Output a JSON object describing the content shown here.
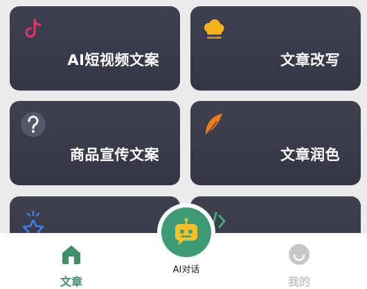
{
  "cards": [
    {
      "title": "AI短视频文案",
      "icon": "tiktok-music-icon"
    },
    {
      "title": "文章改写",
      "icon": "chef-hat-icon"
    },
    {
      "title": "商品宣传文案",
      "icon": "question-icon"
    },
    {
      "title": "文章润色",
      "icon": "feather-icon"
    },
    {
      "title": "",
      "icon": "sparkle-star-icon"
    },
    {
      "title": "",
      "icon": "code-icon"
    }
  ],
  "tabbar": {
    "home_label": "文章",
    "center_label": "AI对话",
    "mine_label": "我的"
  },
  "colors": {
    "card_bg": "#3f4150",
    "accent_green": "#3f9a76",
    "tab_active": "#3f8f6a",
    "tab_inactive": "#c7c7c7"
  }
}
